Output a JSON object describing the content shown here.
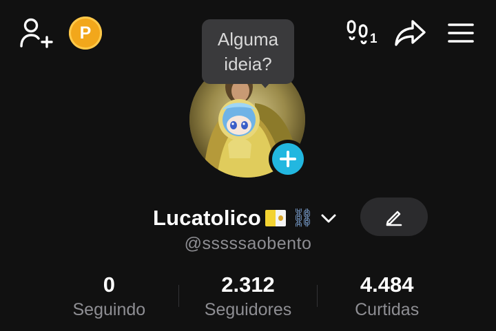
{
  "header": {
    "add_friend_icon": "person-plus-icon",
    "coin_label": "P",
    "steps_icon": "footprints-icon",
    "steps_count": "1",
    "share_icon": "share-arrow-icon",
    "menu_icon": "hamburger-menu-icon"
  },
  "tooltip": {
    "text": "Alguma ideia?"
  },
  "profile": {
    "display_name": "Lucatolico",
    "flag_icon": "vatican-flag-icon",
    "chain_emoji": "⛓",
    "username": "@sssssaobento",
    "edit_icon": "pencil-icon"
  },
  "stats": [
    {
      "value": "0",
      "label": "Seguindo"
    },
    {
      "value": "2.312",
      "label": "Seguidores"
    },
    {
      "value": "4.484",
      "label": "Curtidas"
    }
  ],
  "colors": {
    "background": "#111111",
    "accent_cyan": "#22b7e0",
    "coin": "#f2a71b",
    "muted_text": "#8e8e93",
    "tooltip_bg": "#3a3a3c"
  }
}
